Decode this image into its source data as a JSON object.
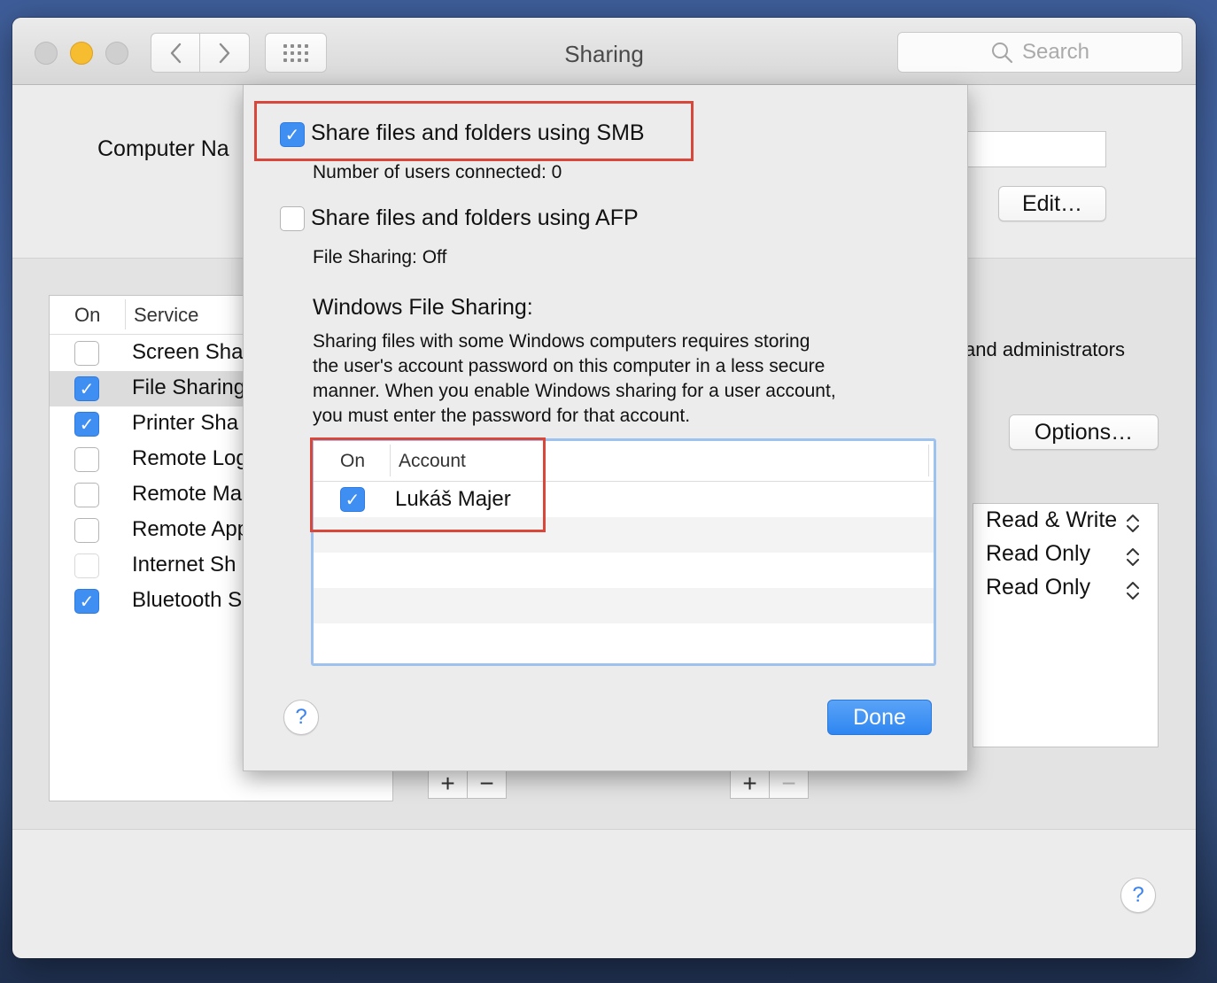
{
  "window": {
    "title": "Sharing",
    "search_placeholder": "Search"
  },
  "background": {
    "computer_name_label": "Computer Na",
    "edit_button": "Edit…",
    "options_button": "Options…",
    "admin_text": "and administrators",
    "services_header": {
      "on": "On",
      "service": "Service"
    },
    "services": [
      {
        "label": "Screen Sha",
        "checked": false
      },
      {
        "label": "File Sharing",
        "checked": true,
        "selected": true
      },
      {
        "label": "Printer Sha",
        "checked": true
      },
      {
        "label": "Remote Log",
        "checked": false
      },
      {
        "label": "Remote Ma",
        "checked": false
      },
      {
        "label": "Remote App",
        "checked": false
      },
      {
        "label": "Internet Sh",
        "checked": false,
        "disabled": true
      },
      {
        "label": "Bluetooth S",
        "checked": true
      }
    ],
    "permissions": [
      {
        "label": "Read & Write"
      },
      {
        "label": "Read Only"
      },
      {
        "label": "Read Only"
      }
    ],
    "plus": "+",
    "minus": "−",
    "help": "?"
  },
  "sheet": {
    "smb": {
      "label": "Share files and folders using SMB",
      "checked": true,
      "status": "Number of users connected: 0"
    },
    "afp": {
      "label": "Share files and folders using AFP",
      "checked": false,
      "status": "File Sharing: Off"
    },
    "windows_heading": "Windows File Sharing:",
    "windows_text_lines": [
      "Sharing files with some Windows computers requires storing",
      "the user's account password on this computer in a less secure",
      "manner.  When you enable Windows sharing for a user account,",
      "you must enter the password for that account."
    ],
    "accounts_header": {
      "on": "On",
      "account": "Account"
    },
    "accounts": [
      {
        "name": "Lukáš Majer",
        "checked": true
      }
    ],
    "help": "?",
    "done_button": "Done"
  },
  "colors": {
    "accent": "#3f8ef2",
    "highlight_box": "#d9473a",
    "traffic_yellow": "#f5bd2f"
  }
}
